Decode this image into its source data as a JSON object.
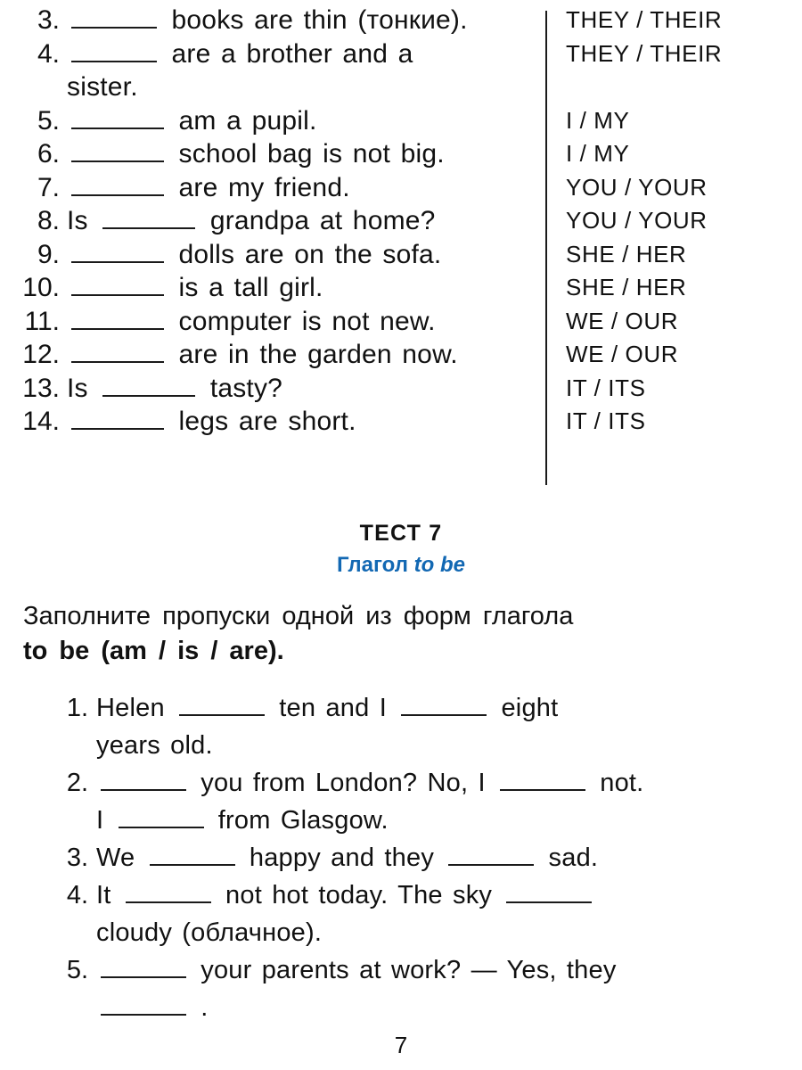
{
  "page": {
    "number": "7"
  },
  "exercise_top": {
    "divider": true,
    "items": [
      {
        "num": "3.",
        "parts": [
          {
            "type": "blank",
            "w": "w1"
          },
          {
            "type": "text",
            "value": "books  are  thin  (тонкие)."
          }
        ],
        "option": "THEY / THEIR"
      },
      {
        "num": "4.",
        "parts": [
          {
            "type": "blank",
            "w": "w1"
          },
          {
            "type": "text",
            "value": "are  a  brother  and  a"
          },
          {
            "type": "break"
          },
          {
            "type": "text",
            "value": "sister."
          }
        ],
        "option": "THEY / THEIR"
      },
      {
        "num": "5.",
        "parts": [
          {
            "type": "blank",
            "w": "w2"
          },
          {
            "type": "text",
            "value": "am  a  pupil."
          }
        ],
        "option": "I / MY"
      },
      {
        "num": "6.",
        "parts": [
          {
            "type": "blank",
            "w": "w2"
          },
          {
            "type": "text",
            "value": "school  bag  is  not  big."
          }
        ],
        "option": "I / MY"
      },
      {
        "num": "7.",
        "parts": [
          {
            "type": "blank",
            "w": "w2"
          },
          {
            "type": "text",
            "value": "are  my  friend."
          }
        ],
        "option": "YOU / YOUR"
      },
      {
        "num": "8.",
        "parts": [
          {
            "type": "text",
            "value": "Is"
          },
          {
            "type": "blank",
            "w": "w2"
          },
          {
            "type": "text",
            "value": "grandpa  at  home?"
          }
        ],
        "option": "YOU / YOUR"
      },
      {
        "num": "9.",
        "parts": [
          {
            "type": "blank",
            "w": "w2"
          },
          {
            "type": "text",
            "value": "dolls  are  on  the  sofa."
          }
        ],
        "option": "SHE / HER"
      },
      {
        "num": "10.",
        "parts": [
          {
            "type": "blank",
            "w": "w2"
          },
          {
            "type": "text",
            "value": "is  a  tall  girl."
          }
        ],
        "option": "SHE / HER"
      },
      {
        "num": "11.",
        "parts": [
          {
            "type": "blank",
            "w": "w2"
          },
          {
            "type": "text",
            "value": "computer  is  not  new."
          }
        ],
        "option": "WE / OUR"
      },
      {
        "num": "12.",
        "parts": [
          {
            "type": "blank",
            "w": "w2"
          },
          {
            "type": "text",
            "value": "are  in  the  garden  now."
          }
        ],
        "option": "WE / OUR"
      },
      {
        "num": "13.",
        "parts": [
          {
            "type": "text",
            "value": "Is"
          },
          {
            "type": "blank",
            "w": "w2"
          },
          {
            "type": "text",
            "value": "tasty?"
          }
        ],
        "option": "IT / ITS"
      },
      {
        "num": "14.",
        "parts": [
          {
            "type": "blank",
            "w": "w2"
          },
          {
            "type": "text",
            "value": "legs  are  short."
          }
        ],
        "option": "IT / ITS"
      }
    ],
    "option_lines": [
      "THEY / THEIR",
      "THEY / THEIR",
      "",
      "I / MY",
      "I / MY",
      "YOU / YOUR",
      "YOU / YOUR",
      "SHE / HER",
      "SHE / HER",
      "WE / OUR",
      "WE / OUR",
      "IT / ITS",
      "IT / ITS"
    ]
  },
  "test_heading": {
    "title": "ТЕСТ 7",
    "subtitle_ru": "Глагол ",
    "subtitle_en": "to be",
    "subtitle_color": "#1268b3"
  },
  "instruction": {
    "line1": "Заполните  пропуски  одной  из  форм  глагола",
    "bold": "to  be  (am / is / are)."
  },
  "exercise_bottom": {
    "items": [
      {
        "num": "1.",
        "parts": [
          {
            "type": "text",
            "value": "Helen"
          },
          {
            "type": "blank",
            "w": "w1"
          },
          {
            "type": "text",
            "value": "ten  and  I"
          },
          {
            "type": "blank",
            "w": "w1"
          },
          {
            "type": "text",
            "value": "eight"
          },
          {
            "type": "break"
          },
          {
            "type": "text",
            "value": "years  old."
          }
        ]
      },
      {
        "num": "2.",
        "parts": [
          {
            "type": "blank",
            "w": "w1"
          },
          {
            "type": "text",
            "value": "you from London? No, I"
          },
          {
            "type": "blank",
            "w": "w1"
          },
          {
            "type": "text",
            "value": "not."
          },
          {
            "type": "break"
          },
          {
            "type": "text",
            "value": "I"
          },
          {
            "type": "blank",
            "w": "w1"
          },
          {
            "type": "text",
            "value": "from  Glasgow."
          }
        ]
      },
      {
        "num": "3.",
        "parts": [
          {
            "type": "text",
            "value": "We"
          },
          {
            "type": "blank",
            "w": "w1"
          },
          {
            "type": "text",
            "value": "happy  and  they"
          },
          {
            "type": "blank",
            "w": "w1"
          },
          {
            "type": "text",
            "value": "sad."
          }
        ]
      },
      {
        "num": "4.",
        "parts": [
          {
            "type": "text",
            "value": "It"
          },
          {
            "type": "blank",
            "w": "w1"
          },
          {
            "type": "text",
            "value": "not hot today. The  sky"
          },
          {
            "type": "blank",
            "w": "w1"
          },
          {
            "type": "break"
          },
          {
            "type": "text",
            "value": "cloudy  (облачное)."
          }
        ]
      },
      {
        "num": "5.",
        "parts": [
          {
            "type": "blank",
            "w": "w1"
          },
          {
            "type": "text",
            "value": "your  parents  at  work?  —  Yes,  they"
          },
          {
            "type": "break"
          },
          {
            "type": "blank",
            "w": "w1"
          },
          {
            "type": "text",
            "value": "."
          }
        ]
      }
    ]
  }
}
